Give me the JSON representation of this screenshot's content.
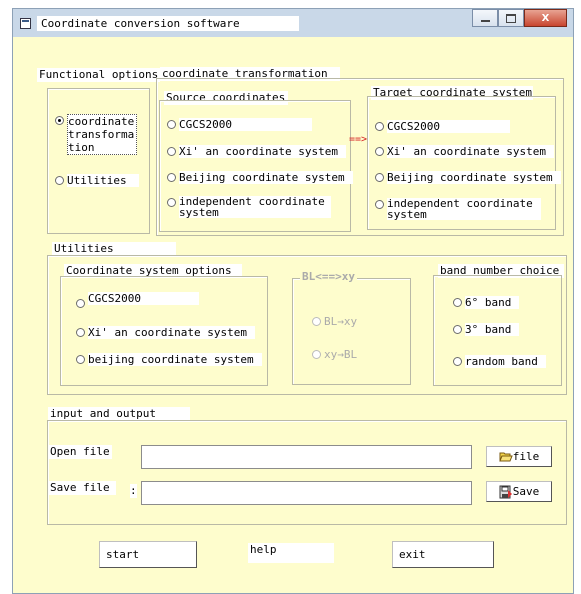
{
  "window": {
    "title": "Coordinate conversion software",
    "icon": "window-app-icon"
  },
  "caption_buttons": {
    "minimize": "minimize-icon",
    "maximize": "maximize-icon",
    "close": "close-icon",
    "close_glyph": "X"
  },
  "functional": {
    "title": "Functional options",
    "opt1": "coordinate\ntransforma\ntion",
    "opt2": "Utilities"
  },
  "transform": {
    "title": "coordinate transformation",
    "source": {
      "title": "Source coordinates",
      "items": [
        "CGCS2000",
        "Xi' an coordinate system",
        "Beijing coordinate system",
        "independent coordinate\nsystem"
      ]
    },
    "arrow": "==>",
    "target": {
      "title": "Target coordinate system",
      "items": [
        "CGCS2000",
        "Xi' an coordinate system",
        "Beijing coordinate system",
        "independent coordinate\nsystem"
      ]
    }
  },
  "utilities": {
    "title": "Utilities",
    "coord_options": {
      "title": "Coordinate system options",
      "items": [
        "CGCS2000",
        "Xi' an coordinate system",
        "beijing coordinate system"
      ]
    },
    "blxy": {
      "title": "BL<==>xy",
      "items": [
        "BL→xy",
        "xy→BL"
      ]
    },
    "band": {
      "title": "band number choice",
      "items": [
        "6° band",
        "3° band",
        "random band"
      ]
    }
  },
  "io": {
    "title": "input and output",
    "open_label": "Open file",
    "save_label": "Save file",
    "save_colon": ":",
    "open_value": "",
    "save_value": "",
    "file_button": "file",
    "save_button": "Save",
    "file_icon": "folder-open-icon",
    "save_icon": "save-disk-icon"
  },
  "actions": {
    "start": "start",
    "help": "help",
    "exit": "exit"
  },
  "state": {
    "functional_selected": "coordinate transformation"
  }
}
